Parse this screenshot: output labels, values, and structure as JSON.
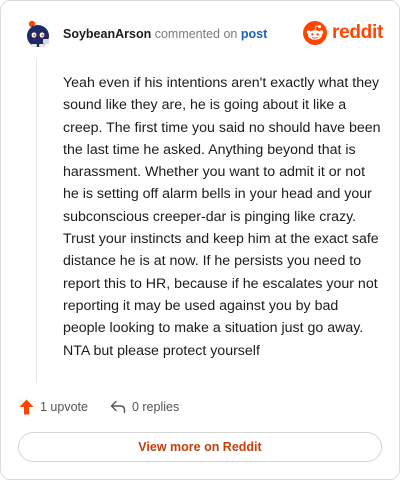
{
  "header": {
    "username": "SoybeanArson",
    "action_text": "commented on",
    "post_link": "post",
    "brand": "reddit"
  },
  "comment": {
    "body": "Yeah even if his intentions aren't exactly what they sound like they are, he is going about it like a creep. The first time you said no should have been the last time he asked. Anything beyond that is harassment. Whether you want to admit it or not he is setting off alarm bells in your head and your subconscious creeper-dar is pinging like crazy. Trust your instincts and keep him at the exact safe distance he is at now. If he persists you need to report this to HR, because if he escalates your not reporting it may be used against you by bad people looking to make a situation just go away. NTA but please protect yourself"
  },
  "footer": {
    "upvote_label": "1 upvote",
    "replies_label": "0 replies",
    "view_more_label": "View more on Reddit"
  },
  "colors": {
    "brand": "#ff4500",
    "link": "#1a5fc2",
    "view_more": "#c2410c"
  },
  "icons": [
    "user-avatar",
    "reddit-logo-icon",
    "upvote-arrow-icon",
    "reply-icon"
  ]
}
